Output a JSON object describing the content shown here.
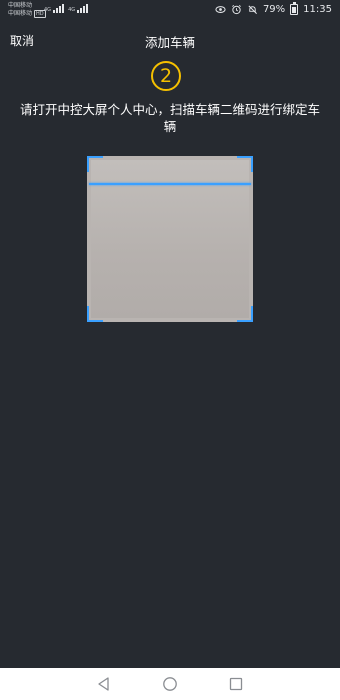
{
  "status_bar": {
    "carrier_1": "中国移动",
    "carrier_2": "中国移动",
    "hd_badge": "HD",
    "network_1": "4G",
    "network_2": "4G",
    "battery_percent": "79%",
    "time": "11:35",
    "icons": [
      "eye-icon",
      "alarm-icon",
      "mute-icon",
      "battery-icon"
    ]
  },
  "header": {
    "cancel_label": "取消",
    "title": "添加车辆"
  },
  "step": {
    "number": "2",
    "color": "#f5c000"
  },
  "instruction": "请打开中控大屏个人中心，扫描车辆二维码进行绑定车辆",
  "scanner": {
    "frame_color": "#3aa0ff"
  },
  "nav_bar": {
    "buttons": [
      "back-icon",
      "home-icon",
      "recent-apps-icon"
    ]
  }
}
